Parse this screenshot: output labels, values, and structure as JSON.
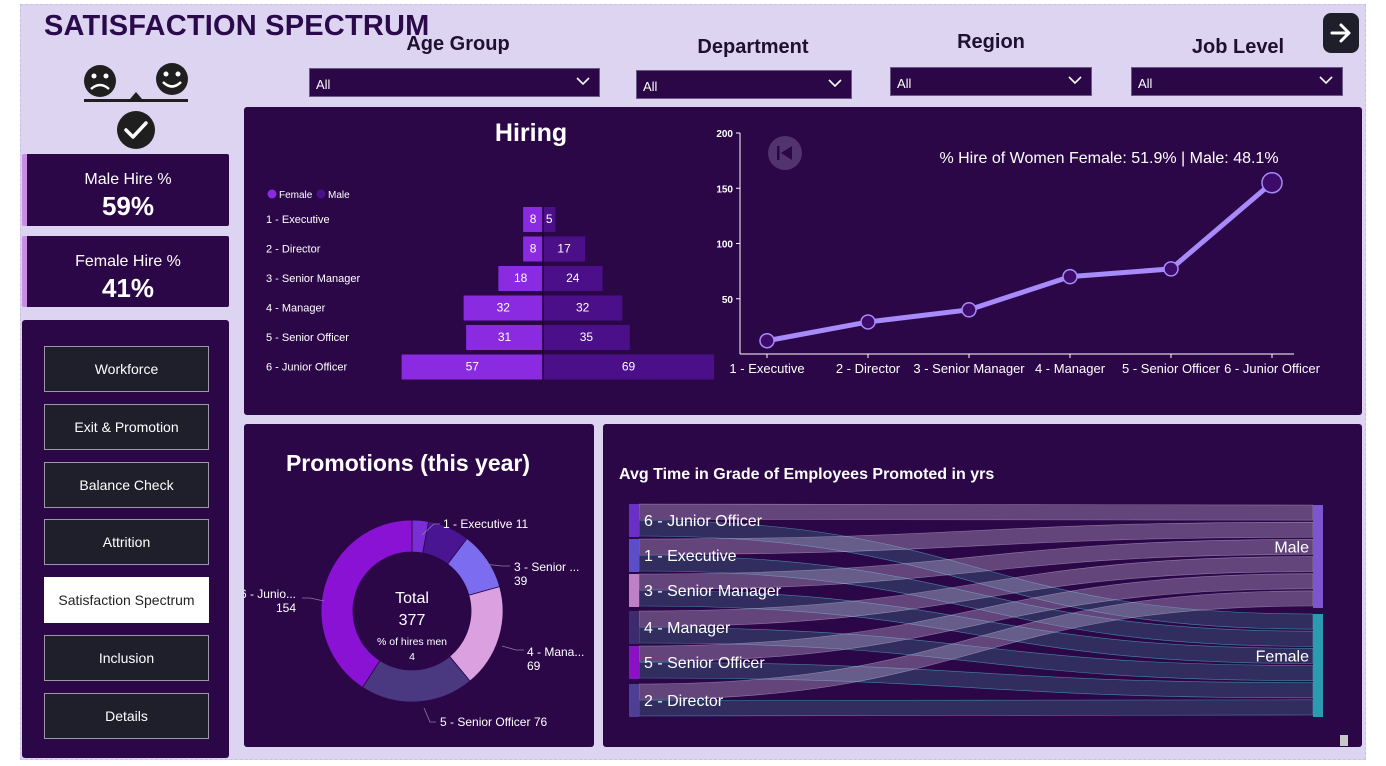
{
  "title": "SATISFACTION SPECTRUM",
  "filters": [
    {
      "label": "Age Group",
      "value": "All"
    },
    {
      "label": "Department",
      "value": "All"
    },
    {
      "label": "Region",
      "value": "All"
    },
    {
      "label": "Job Level",
      "value": "All"
    }
  ],
  "kpis": {
    "male": {
      "label": "Male Hire %",
      "value": "59%"
    },
    "female": {
      "label": "Female Hire %",
      "value": "41%"
    }
  },
  "nav": {
    "items": [
      "Workforce",
      "Exit & Promotion",
      "Balance Check",
      "Attrition",
      "Satisfaction Spectrum",
      "Inclusion",
      "Details"
    ],
    "active": "Satisfaction Spectrum"
  },
  "icons": {
    "next": "arrow-right-icon",
    "logo": [
      "sad-face-icon",
      "happy-face-icon",
      "balance-scale-icon",
      "checkmark-icon"
    ],
    "reset": "skip-to-start-icon",
    "dropdown": "chevron-down-icon"
  },
  "colors": {
    "background": "#ddd4f2",
    "panel": "#2c0748",
    "female": "#8a2be2",
    "male": "#4b0f8a",
    "line": "#a78bfa"
  },
  "hiring": {
    "title": "Hiring",
    "legend": [
      "Female",
      "Male"
    ],
    "line_annotation": "% Hire of Women Female: 51.9% | Male: 48.1%"
  },
  "promotions": {
    "title": "Promotions (this year)",
    "center_label": "Total",
    "center_value": "377",
    "center_sub_label": "% of hires men",
    "center_sub_value": "4",
    "slice_labels": [
      {
        "name": "1 - Executive 11",
        "value": ""
      },
      {
        "name": "3 - Senior ...",
        "value": "39"
      },
      {
        "name": "4 - Mana...",
        "value": "69"
      },
      {
        "name": "5 - Senior Officer 76",
        "value": ""
      },
      {
        "name": "6 - Junio...",
        "value": "154"
      }
    ]
  },
  "sankey": {
    "title": "Avg Time in Grade of Employees Promoted in yrs",
    "sources": [
      "6 - Junior Officer",
      "1 - Executive",
      "3 - Senior Manager",
      "4 - Manager",
      "5 - Senior Officer",
      "2 - Director"
    ],
    "targets": [
      "Male",
      "Female"
    ]
  },
  "chart_data": [
    {
      "type": "bar",
      "title": "Hiring",
      "categories": [
        "1 - Executive",
        "2 - Director",
        "3 - Senior Manager",
        "4 - Manager",
        "5 - Senior Officer",
        "6 - Junior Officer"
      ],
      "series": [
        {
          "name": "Female",
          "values": [
            8,
            8,
            18,
            32,
            31,
            57
          ]
        },
        {
          "name": "Male",
          "values": [
            5,
            17,
            24,
            32,
            35,
            69
          ]
        }
      ],
      "orientation": "horizontal-diverging",
      "legend": "top-left"
    },
    {
      "type": "line",
      "categories": [
        "1 - Executive",
        "2 - Director",
        "3 - Senior Manager",
        "4 - Manager",
        "5 - Senior Officer",
        "6 - Junior Officer"
      ],
      "values": [
        12,
        29,
        40,
        70,
        77,
        155
      ],
      "ylim": [
        0,
        200
      ],
      "yticks": [
        50,
        100,
        150,
        200
      ]
    },
    {
      "type": "pie",
      "title": "Promotions (this year)",
      "categories": [
        "1 - Executive",
        "2 - Director",
        "3 - Senior Manager",
        "4 - Manager",
        "5 - Senior Officer",
        "6 - Junior Officer"
      ],
      "values": [
        11,
        28,
        39,
        69,
        76,
        154
      ],
      "total": 377
    }
  ]
}
